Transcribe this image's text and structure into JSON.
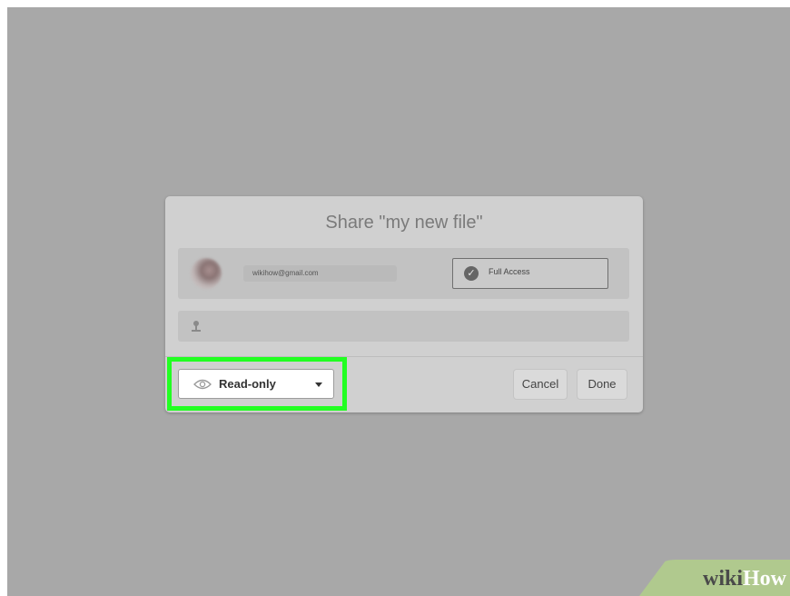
{
  "dialog": {
    "title": "Share \"my new file\"",
    "share_row": {
      "email": "wikihow@gmail.com",
      "access_label": "Full Access"
    },
    "footer": {
      "permission_label": "Read-only",
      "cancel_label": "Cancel",
      "done_label": "Done"
    }
  },
  "watermark": {
    "wiki": "wiki",
    "how": "How"
  },
  "colors": {
    "highlight": "#22ff22",
    "backdrop": "#a8a8a8",
    "watermark_bg": "#b0c98e"
  },
  "icons": [
    "check-icon",
    "person-icon",
    "eye-icon",
    "caret-down-icon"
  ]
}
